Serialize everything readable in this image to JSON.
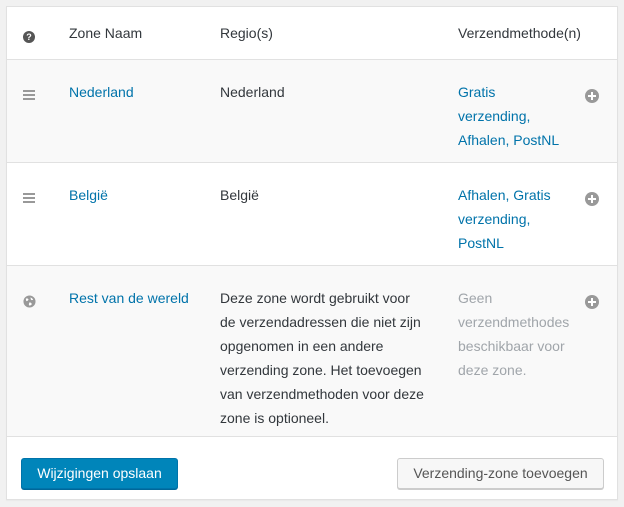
{
  "table": {
    "headers": {
      "help_icon": "help-icon",
      "zone_name": "Zone Naam",
      "regions": "Regio(s)",
      "methods": "Verzendmethode(n)"
    },
    "rows": [
      {
        "icon": "drag-handle-icon",
        "name": "Nederland",
        "region": "Nederland",
        "methods_lines": [
          "Gratis",
          "verzending,",
          "Afhalen, PostNL"
        ],
        "add_icon": "plus-circle-icon"
      },
      {
        "icon": "drag-handle-icon",
        "name": "België",
        "region": "België",
        "methods_lines": [
          "Afhalen, Gratis",
          "verzending,",
          "PostNL"
        ],
        "add_icon": "plus-circle-icon"
      },
      {
        "icon": "globe-icon",
        "name": "Rest van de wereld",
        "region_lines": [
          "Deze zone wordt gebruikt voor",
          "de verzendadressen die niet zijn",
          "opgenomen in een andere",
          "verzending zone. Het toevoegen",
          "van verzendmethoden voor deze",
          "zone is optioneel."
        ],
        "methods_lines": [
          "Geen",
          "verzendmethodes",
          "beschikbaar voor",
          "deze zone."
        ],
        "add_icon": "plus-circle-icon"
      }
    ]
  },
  "footer": {
    "save_label": "Wijzigingen opslaan",
    "add_zone_label": "Verzending-zone toevoegen"
  },
  "colors": {
    "link": "#0073aa",
    "primary_button": "#0085ba",
    "muted_text": "#a0a5aa"
  }
}
